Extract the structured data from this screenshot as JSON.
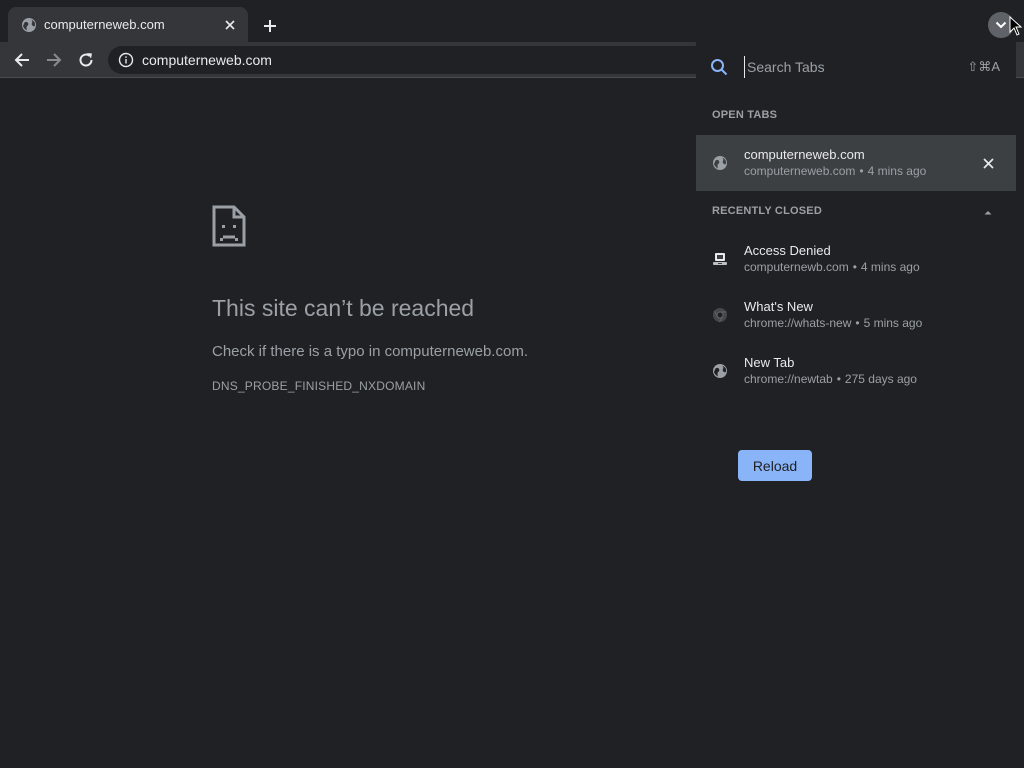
{
  "tab": {
    "title": "computerneweb.com",
    "favicon": "globe-icon"
  },
  "omnibox": {
    "url": "computerneweb.com"
  },
  "error": {
    "title": "This site can’t be reached",
    "message": "Check if there is a typo in computerneweb.com.",
    "code": "DNS_PROBE_FINISHED_NXDOMAIN",
    "reload_label": "Reload"
  },
  "tab_search": {
    "placeholder": "Search Tabs",
    "shortcut": "⇧⌘A",
    "open_tabs_header": "OPEN TABS",
    "recently_closed_header": "RECENTLY CLOSED",
    "open_tabs": [
      {
        "title": "computerneweb.com",
        "url": "computerneweb.com",
        "time": "4 mins ago",
        "icon": "globe-icon"
      }
    ],
    "recently_closed": [
      {
        "title": "Access Denied",
        "url": "computernewb.com",
        "time": "4 mins ago",
        "icon": "site-favicon-icon"
      },
      {
        "title": "What's New",
        "url": "chrome://whats-new",
        "time": "5 mins ago",
        "icon": "chrome-icon"
      },
      {
        "title": "New Tab",
        "url": "chrome://newtab",
        "time": "275 days ago",
        "icon": "globe-icon"
      }
    ]
  },
  "colors": {
    "background": "#202124",
    "toolbar": "#35363a",
    "accent": "#8ab4f8",
    "selected_row": "#3c4043"
  }
}
